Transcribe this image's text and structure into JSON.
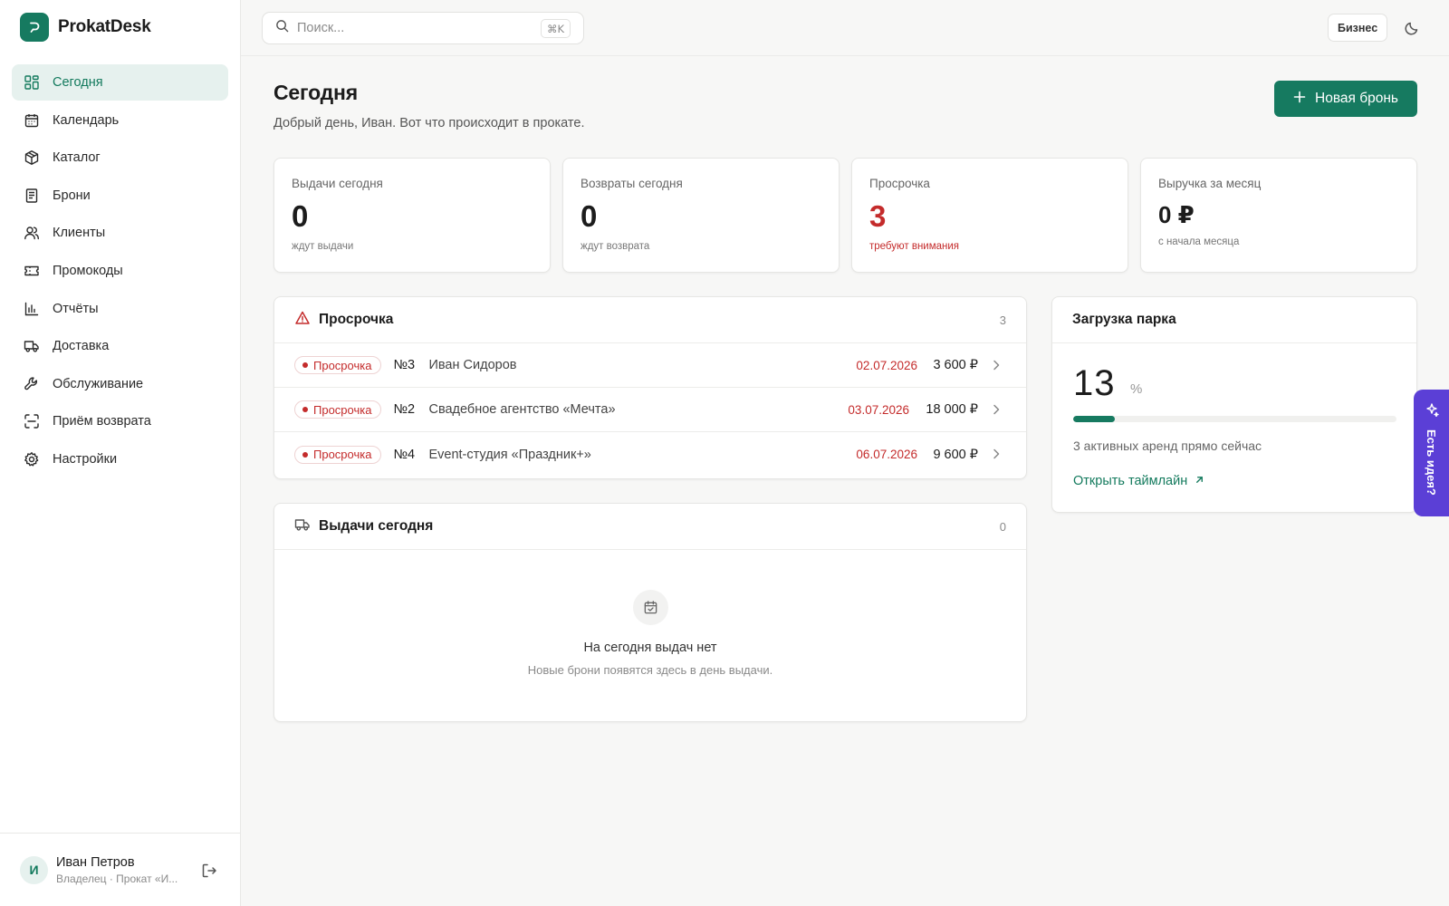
{
  "app": {
    "name": "ProkatDesk",
    "accent_color": "#167a60",
    "danger_color": "#c42b2b"
  },
  "sidebar": {
    "items": [
      {
        "label": "Сегодня",
        "icon": "dashboard-icon",
        "active": true
      },
      {
        "label": "Календарь",
        "icon": "calendar-icon"
      },
      {
        "label": "Каталог",
        "icon": "box-icon"
      },
      {
        "label": "Брони",
        "icon": "document-icon"
      },
      {
        "label": "Клиенты",
        "icon": "users-icon"
      },
      {
        "label": "Промокоды",
        "icon": "ticket-icon"
      },
      {
        "label": "Отчёты",
        "icon": "bar-chart-icon"
      },
      {
        "label": "Доставка",
        "icon": "truck-icon"
      },
      {
        "label": "Обслуживание",
        "icon": "wrench-icon"
      },
      {
        "label": "Приём возврата",
        "icon": "scan-icon"
      },
      {
        "label": "Настройки",
        "icon": "gear-icon"
      }
    ],
    "user": {
      "initial": "И",
      "name": "Иван Петров",
      "role": "Владелец · Прокат «И..."
    }
  },
  "topbar": {
    "search_placeholder": "Поиск...",
    "search_shortcut": "⌘K",
    "plan": "Бизнес"
  },
  "page": {
    "title": "Сегодня",
    "subtitle": "Добрый день, Иван. Вот что происходит в прокате.",
    "new_button": "Новая бронь"
  },
  "stats": [
    {
      "label": "Выдачи сегодня",
      "value": "0",
      "sub": "ждут выдачи"
    },
    {
      "label": "Возвраты сегодня",
      "value": "0",
      "sub": "ждут возврата"
    },
    {
      "label": "Просрочка",
      "value": "3",
      "sub": "требуют внимания"
    },
    {
      "label": "Выручка за месяц",
      "value": "0 ₽",
      "sub": "с начала месяца"
    }
  ],
  "overdue": {
    "title": "Просрочка",
    "count": "3",
    "badge": "Просрочка",
    "rows": [
      {
        "num": "№3",
        "name": "Иван Сидоров",
        "date": "02.07.2026",
        "amount": "3 600 ₽"
      },
      {
        "num": "№2",
        "name": "Свадебное агентство «Мечта»",
        "date": "03.07.2026",
        "amount": "18 000 ₽"
      },
      {
        "num": "№4",
        "name": "Event-студия «Праздник+»",
        "date": "06.07.2026",
        "amount": "9 600 ₽"
      }
    ]
  },
  "issues_today": {
    "title": "Выдачи сегодня",
    "count": "0",
    "empty_title": "На сегодня выдач нет",
    "empty_sub": "Новые брони появятся здесь в день выдачи."
  },
  "fleet_load": {
    "title": "Загрузка парка",
    "value": "13",
    "unit": "%",
    "fraction": 0.13,
    "text": "3 активных аренд прямо сейчас",
    "link": "Открыть таймлайн"
  },
  "feedback_tab": {
    "label": "Есть идея?"
  }
}
